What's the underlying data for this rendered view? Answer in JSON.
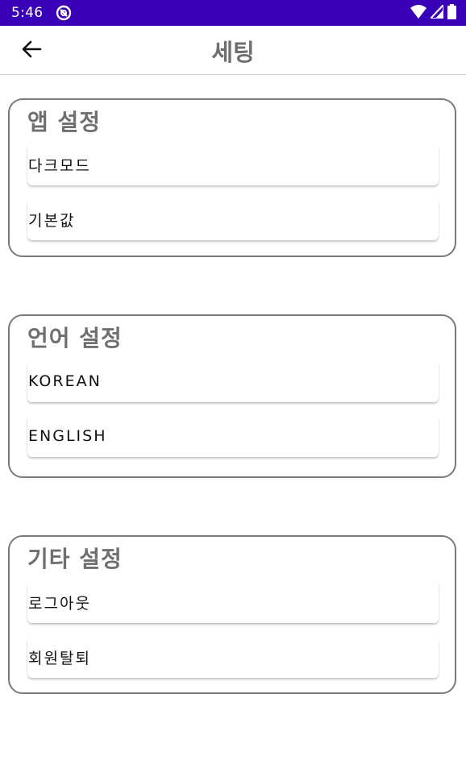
{
  "status_bar": {
    "time": "5:46",
    "icons": [
      "app-notification-icon",
      "wifi-icon",
      "signal-icon",
      "battery-icon"
    ],
    "background_color": "#3a00b8"
  },
  "app_bar": {
    "title": "세팅",
    "back_icon": "arrow-left-icon"
  },
  "sections": [
    {
      "title": "앱 설정",
      "items": [
        "다크모드",
        "기본값"
      ]
    },
    {
      "title": "언어 설정",
      "items": [
        "KOREAN",
        "ENGLISH"
      ]
    },
    {
      "title": "기타 설정",
      "items": [
        "로그아웃",
        "회원탈퇴"
      ]
    }
  ],
  "colors": {
    "title_text": "#6e6e6e",
    "card_border": "#7a7a7a"
  }
}
